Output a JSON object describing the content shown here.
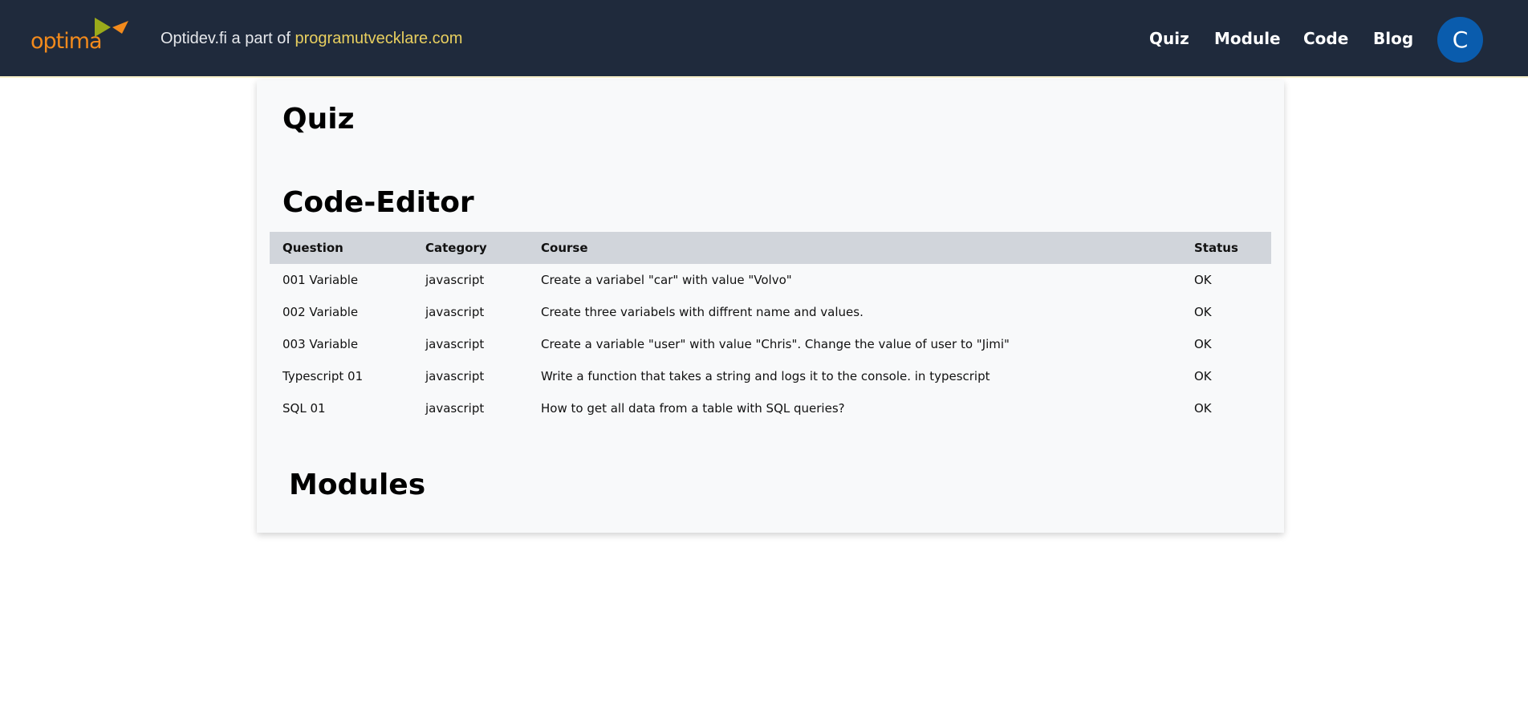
{
  "header": {
    "logo_text": "optima",
    "tagline_prefix": "Optidev.fi a part of",
    "tagline_link": "programutvecklare.com",
    "nav": [
      "Quiz",
      "Module",
      "Code",
      "Blog"
    ],
    "avatar_initial": "C"
  },
  "main": {
    "quiz_heading": "Quiz",
    "code_editor_heading": "Code-Editor",
    "modules_heading": "Modules",
    "table": {
      "columns": [
        "Question",
        "Category",
        "Course",
        "Status"
      ],
      "rows": [
        [
          "001 Variable",
          "javascript",
          "Create a variabel \"car\" with value \"Volvo\"",
          "OK"
        ],
        [
          "002 Variable",
          "javascript",
          "Create three variabels with diffrent name and values.",
          "OK"
        ],
        [
          "003 Variable",
          "javascript",
          "Create a variable \"user\" with value \"Chris\". Change the value of user to \"Jimi\"",
          "OK"
        ],
        [
          "Typescript 01",
          "javascript",
          "Write a function that takes a string and logs it to the console. in typescript",
          "OK"
        ],
        [
          "SQL 01",
          "javascript",
          "How to get all data from a table with SQL queries?",
          "OK"
        ]
      ]
    }
  },
  "colors": {
    "navbar_bg": "#1f2a3c",
    "logo_orange": "#f28a1c",
    "logo_green": "#9aaa1a",
    "link_yellow": "#e8cf5f",
    "avatar_blue": "#0a5cad",
    "table_header_bg": "#d1d5db",
    "card_bg": "#f8f9fa"
  }
}
